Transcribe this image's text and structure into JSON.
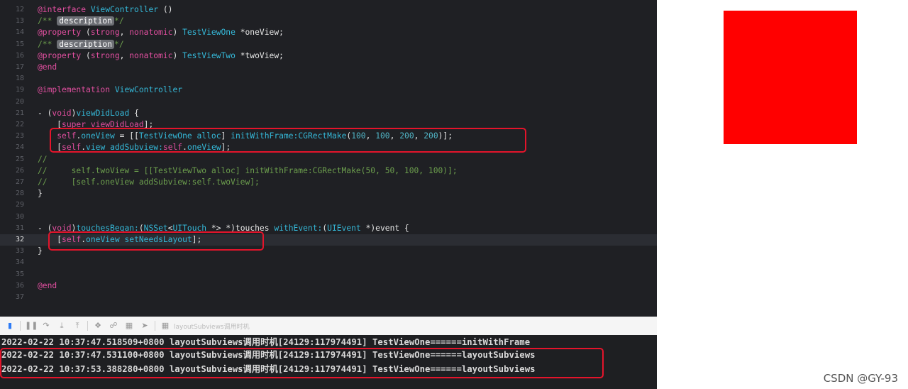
{
  "editor": {
    "lines": [
      {
        "num": "12",
        "seg": [
          {
            "t": "@interface",
            "c": "kw"
          },
          {
            "t": " "
          },
          {
            "t": "ViewController",
            "c": "ty"
          },
          {
            "t": " ()"
          }
        ]
      },
      {
        "num": "13",
        "seg": [
          {
            "t": "/** ",
            "c": "cm"
          },
          {
            "t": "description",
            "c": "tag"
          },
          {
            "t": "*/",
            "c": "cm"
          }
        ]
      },
      {
        "num": "14",
        "seg": [
          {
            "t": "@property",
            "c": "kw"
          },
          {
            "t": " ("
          },
          {
            "t": "strong",
            "c": "kw"
          },
          {
            "t": ", "
          },
          {
            "t": "nonatomic",
            "c": "kw"
          },
          {
            "t": ") "
          },
          {
            "t": "TestViewOne",
            "c": "ty"
          },
          {
            "t": " *oneView;"
          }
        ]
      },
      {
        "num": "15",
        "seg": [
          {
            "t": "/** ",
            "c": "cm"
          },
          {
            "t": "description",
            "c": "tag"
          },
          {
            "t": "*/",
            "c": "cm"
          }
        ]
      },
      {
        "num": "16",
        "seg": [
          {
            "t": "@property",
            "c": "kw"
          },
          {
            "t": " ("
          },
          {
            "t": "strong",
            "c": "kw"
          },
          {
            "t": ", "
          },
          {
            "t": "nonatomic",
            "c": "kw"
          },
          {
            "t": ") "
          },
          {
            "t": "TestViewTwo",
            "c": "ty"
          },
          {
            "t": " *twoView;"
          }
        ]
      },
      {
        "num": "17",
        "seg": [
          {
            "t": "@end",
            "c": "kw"
          }
        ]
      },
      {
        "num": "18",
        "seg": []
      },
      {
        "num": "19",
        "seg": [
          {
            "t": "@implementation",
            "c": "kw"
          },
          {
            "t": " "
          },
          {
            "t": "ViewController",
            "c": "ty"
          }
        ]
      },
      {
        "num": "20",
        "seg": []
      },
      {
        "num": "21",
        "seg": [
          {
            "t": "- ("
          },
          {
            "t": "void",
            "c": "kw"
          },
          {
            "t": ")"
          },
          {
            "t": "viewDidLoad",
            "c": "ty"
          },
          {
            "t": " {"
          }
        ]
      },
      {
        "num": "22",
        "seg": [
          {
            "t": "    ["
          },
          {
            "t": "super",
            "c": "kw"
          },
          {
            "t": " "
          },
          {
            "t": "viewDidLoad",
            "c": "kw"
          },
          {
            "t": "];"
          }
        ]
      },
      {
        "num": "23",
        "seg": [
          {
            "t": "    "
          },
          {
            "t": "self",
            "c": "kw"
          },
          {
            "t": "."
          },
          {
            "t": "oneView",
            "c": "ty"
          },
          {
            "t": " = [["
          },
          {
            "t": "TestViewOne",
            "c": "ty"
          },
          {
            "t": " "
          },
          {
            "t": "alloc",
            "c": "ty"
          },
          {
            "t": "] "
          },
          {
            "t": "initWithFrame:",
            "c": "ty"
          },
          {
            "t": "CGRectMake",
            "c": "ty"
          },
          {
            "t": "("
          },
          {
            "t": "100",
            "c": "num"
          },
          {
            "t": ", "
          },
          {
            "t": "100",
            "c": "num"
          },
          {
            "t": ", "
          },
          {
            "t": "200",
            "c": "num"
          },
          {
            "t": ", "
          },
          {
            "t": "200",
            "c": "num"
          },
          {
            "t": ")];"
          }
        ]
      },
      {
        "num": "24",
        "seg": [
          {
            "t": "    ["
          },
          {
            "t": "self",
            "c": "kw"
          },
          {
            "t": "."
          },
          {
            "t": "view",
            "c": "ty"
          },
          {
            "t": " "
          },
          {
            "t": "addSubview:",
            "c": "ty"
          },
          {
            "t": "self",
            "c": "kw"
          },
          {
            "t": "."
          },
          {
            "t": "oneView",
            "c": "ty"
          },
          {
            "t": "];"
          }
        ]
      },
      {
        "num": "25",
        "seg": [
          {
            "t": "//",
            "c": "cm"
          }
        ]
      },
      {
        "num": "26",
        "seg": [
          {
            "t": "//     self.twoView = [[TestViewTwo alloc] initWithFrame:CGRectMake(50, 50, 100, 100)];",
            "c": "cm"
          }
        ]
      },
      {
        "num": "27",
        "seg": [
          {
            "t": "//     [self.oneView addSubview:self.twoView];",
            "c": "cm"
          }
        ]
      },
      {
        "num": "28",
        "seg": [
          {
            "t": "}"
          }
        ]
      },
      {
        "num": "29",
        "seg": []
      },
      {
        "num": "30",
        "seg": []
      },
      {
        "num": "31",
        "seg": [
          {
            "t": "- ("
          },
          {
            "t": "void",
            "c": "kw"
          },
          {
            "t": ")"
          },
          {
            "t": "touchesBegan:",
            "c": "ty"
          },
          {
            "t": "("
          },
          {
            "t": "NSSet",
            "c": "ty"
          },
          {
            "t": "<"
          },
          {
            "t": "UITouch",
            "c": "ty"
          },
          {
            "t": " *> *)touches "
          },
          {
            "t": "withEvent:",
            "c": "ty"
          },
          {
            "t": "("
          },
          {
            "t": "UIEvent",
            "c": "ty"
          },
          {
            "t": " *)event {"
          }
        ]
      },
      {
        "num": "32",
        "seg": [
          {
            "t": "    ["
          },
          {
            "t": "self",
            "c": "kw"
          },
          {
            "t": "."
          },
          {
            "t": "oneView",
            "c": "ty"
          },
          {
            "t": " "
          },
          {
            "t": "setNeedsLayout",
            "c": "ty"
          },
          {
            "t": "];"
          }
        ]
      },
      {
        "num": "33",
        "seg": [
          {
            "t": "}"
          }
        ]
      },
      {
        "num": "34",
        "seg": []
      },
      {
        "num": "35",
        "seg": []
      },
      {
        "num": "36",
        "seg": [
          {
            "t": "@end",
            "c": "kw"
          }
        ]
      },
      {
        "num": "37",
        "seg": []
      }
    ]
  },
  "debug_bar": {
    "filter_label": "layoutSubviews调用时机",
    "icons": [
      "breakpoint-toggle-icon",
      "pause-icon",
      "step-over-icon",
      "step-into-icon",
      "step-out-icon",
      "debug-view-hierarchy-icon",
      "memory-graph-icon",
      "environment-override-icon",
      "location-icon",
      "filter-icon"
    ]
  },
  "console": {
    "logs": [
      "2022-02-22 10:37:47.518509+0800 layoutSubviews调用时机[24129:117974491] TestViewOne======initWithFrame",
      "2022-02-22 10:37:47.531100+0800 layoutSubviews调用时机[24129:117974491] TestViewOne======layoutSubviews",
      "2022-02-22 10:37:53.388280+0800 layoutSubviews调用时机[24129:117974491] TestViewOne======layoutSubviews"
    ]
  },
  "simulator": {
    "square_color": "#ff0000"
  },
  "watermark": "CSDN @GY-93",
  "colors": {
    "highlight_box": "#e4142b",
    "editor_bg": "#1f2024",
    "console_bg": "#1e1f22"
  }
}
